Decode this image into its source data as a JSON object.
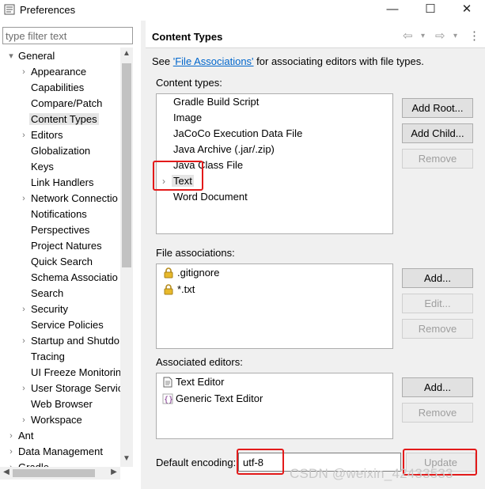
{
  "window": {
    "title": "Preferences",
    "minimize": "—",
    "maximize": "☐",
    "close": "✕"
  },
  "filter": {
    "placeholder": "type filter text"
  },
  "tree": [
    {
      "label": "General",
      "indent": 0,
      "toggle": "▾"
    },
    {
      "label": "Appearance",
      "indent": 1,
      "toggle": "›"
    },
    {
      "label": "Capabilities",
      "indent": 1,
      "toggle": ""
    },
    {
      "label": "Compare/Patch",
      "indent": 1,
      "toggle": ""
    },
    {
      "label": "Content Types",
      "indent": 1,
      "toggle": "",
      "selected": true
    },
    {
      "label": "Editors",
      "indent": 1,
      "toggle": "›"
    },
    {
      "label": "Globalization",
      "indent": 1,
      "toggle": ""
    },
    {
      "label": "Keys",
      "indent": 1,
      "toggle": ""
    },
    {
      "label": "Link Handlers",
      "indent": 1,
      "toggle": ""
    },
    {
      "label": "Network Connectio",
      "indent": 1,
      "toggle": "›"
    },
    {
      "label": "Notifications",
      "indent": 1,
      "toggle": ""
    },
    {
      "label": "Perspectives",
      "indent": 1,
      "toggle": ""
    },
    {
      "label": "Project Natures",
      "indent": 1,
      "toggle": ""
    },
    {
      "label": "Quick Search",
      "indent": 1,
      "toggle": ""
    },
    {
      "label": "Schema Associatio",
      "indent": 1,
      "toggle": ""
    },
    {
      "label": "Search",
      "indent": 1,
      "toggle": ""
    },
    {
      "label": "Security",
      "indent": 1,
      "toggle": "›"
    },
    {
      "label": "Service Policies",
      "indent": 1,
      "toggle": ""
    },
    {
      "label": "Startup and Shutdo",
      "indent": 1,
      "toggle": "›"
    },
    {
      "label": "Tracing",
      "indent": 1,
      "toggle": ""
    },
    {
      "label": "UI Freeze Monitorin",
      "indent": 1,
      "toggle": ""
    },
    {
      "label": "User Storage Servic",
      "indent": 1,
      "toggle": "›"
    },
    {
      "label": "Web Browser",
      "indent": 1,
      "toggle": ""
    },
    {
      "label": "Workspace",
      "indent": 1,
      "toggle": "›"
    },
    {
      "label": "Ant",
      "indent": 0,
      "toggle": "›"
    },
    {
      "label": "Data Management",
      "indent": 0,
      "toggle": "›"
    },
    {
      "label": "Gradle",
      "indent": 0,
      "toggle": "›"
    }
  ],
  "page": {
    "title": "Content Types",
    "nav": {
      "back": "⇦",
      "back_menu": "▾",
      "forward": "⇨",
      "forward_menu": "▾",
      "menu": "⋮"
    },
    "intro_prefix": "See ",
    "intro_link": "'File Associations'",
    "intro_suffix": " for associating editors with file types.",
    "content_types_label": "Content types:",
    "content_types": [
      {
        "label": "Gradle Build Script",
        "toggle": ""
      },
      {
        "label": "Image",
        "toggle": ""
      },
      {
        "label": "JaCoCo Execution Data File",
        "toggle": ""
      },
      {
        "label": "Java Archive (.jar/.zip)",
        "toggle": ""
      },
      {
        "label": "Java Class File",
        "toggle": ""
      },
      {
        "label": "Text",
        "toggle": "›",
        "selected": true
      },
      {
        "label": "Word Document",
        "toggle": ""
      }
    ],
    "buttons": {
      "add_root": "Add Root...",
      "add_child": "Add Child...",
      "remove": "Remove",
      "add": "Add...",
      "edit": "Edit...",
      "update": "Update"
    },
    "file_assoc_label": "File associations:",
    "file_associations": [
      ".gitignore",
      "*.txt"
    ],
    "assoc_editors_label": "Associated editors:",
    "associated_editors": [
      "Text Editor",
      "Generic Text Editor"
    ],
    "default_encoding_label": "Default encoding:",
    "default_encoding_value": "utf-8"
  },
  "watermark": "CSDN @weixin_42433533",
  "colors": {
    "highlight": "#e31a1a",
    "link": "#0066cc",
    "selection": "#e5e5e5"
  }
}
